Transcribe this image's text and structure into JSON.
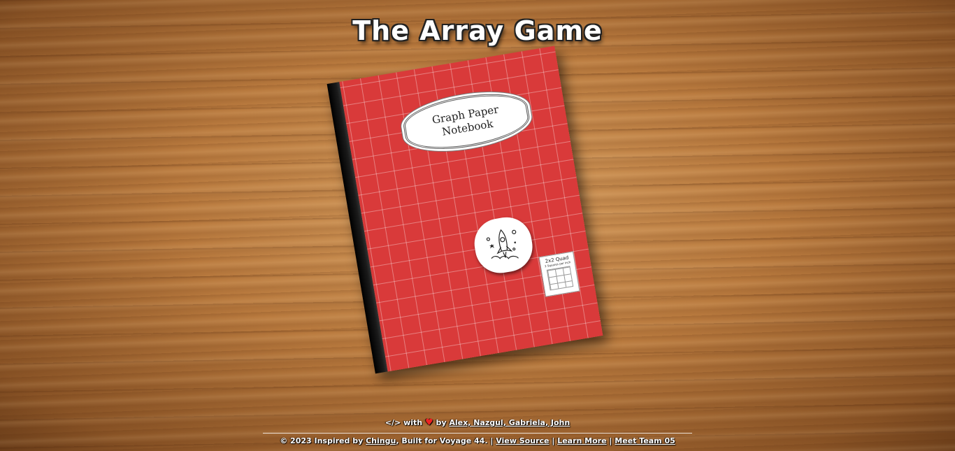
{
  "title": "The Array Game",
  "notebook": {
    "label_line1": "Graph Paper",
    "label_line2": "Notebook",
    "quad_title": "2x2 Quad",
    "quad_sub": "2 Squares per inch",
    "cover_color": "#d93a3a"
  },
  "footer": {
    "code_symbol": "</>",
    "with_text": "with",
    "heart": "♥",
    "by_text": "by",
    "authors": "Alex, Nazgul, Gabriela, John",
    "copyright": "© 2023 Inspired by",
    "chingu_link": "Chingu",
    "built_for": "Built for Voyage 44.",
    "sep": "|",
    "view_source": "View Source",
    "learn_more": "Learn More",
    "meet_team": "Meet Team 05"
  }
}
